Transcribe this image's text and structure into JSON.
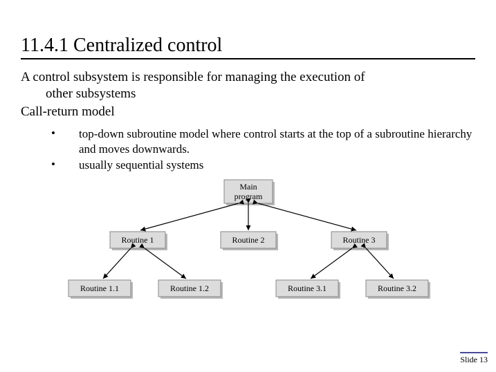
{
  "title": "11.4.1 Centralized control",
  "para1_line1": "A control subsystem is responsible for managing the execution of",
  "para1_line2": "other subsystems",
  "para2": "Call-return model",
  "bullets": [
    "top-down subroutine model where control starts at the top of a subroutine hierarchy and moves downwards.",
    "usually sequential systems"
  ],
  "diagram": {
    "root": "Main program",
    "level1": [
      "Routine 1",
      "Routine 2",
      "Routine 3"
    ],
    "level2": [
      "Routine 1.1",
      "Routine 1.2",
      "Routine 3.1",
      "Routine 3.2"
    ]
  },
  "footer": "Slide 13"
}
